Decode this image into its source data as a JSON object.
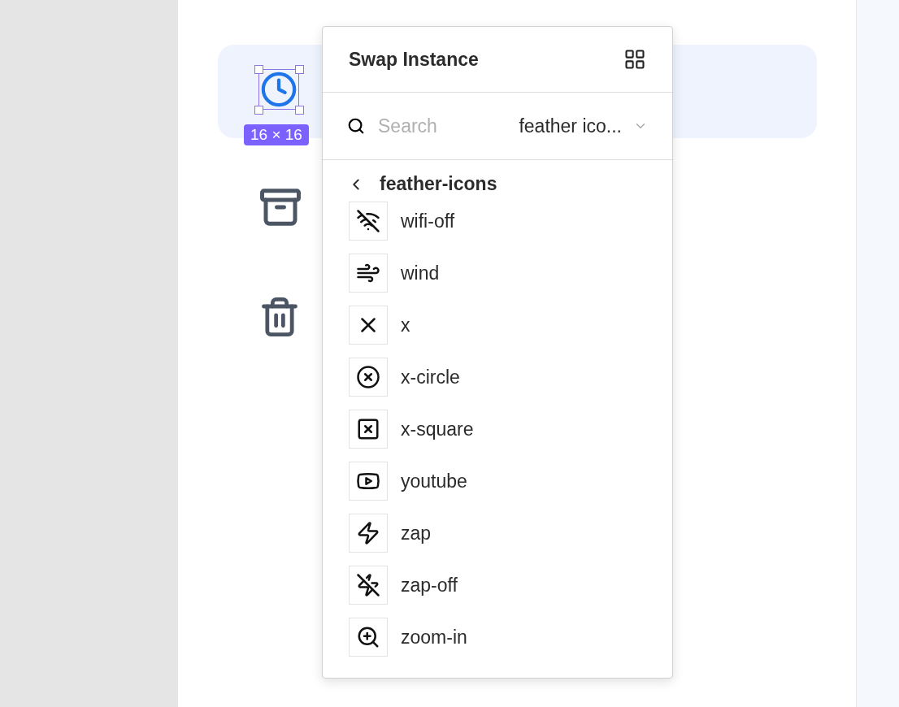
{
  "canvas": {
    "size_badge": "16 × 16"
  },
  "swap_instance": {
    "title": "Swap Instance",
    "search": {
      "placeholder": "Search"
    },
    "library": {
      "value": "feather ico..."
    },
    "back_label": "feather-icons",
    "items": [
      {
        "label": "wifi-off",
        "kind": "wifi-off"
      },
      {
        "label": "wind",
        "kind": "wind"
      },
      {
        "label": "x",
        "kind": "x"
      },
      {
        "label": "x-circle",
        "kind": "x-circle"
      },
      {
        "label": "x-square",
        "kind": "x-square"
      },
      {
        "label": "youtube",
        "kind": "youtube"
      },
      {
        "label": "zap",
        "kind": "zap"
      },
      {
        "label": "zap-off",
        "kind": "zap-off"
      },
      {
        "label": "zoom-in",
        "kind": "zoom-in"
      }
    ]
  }
}
